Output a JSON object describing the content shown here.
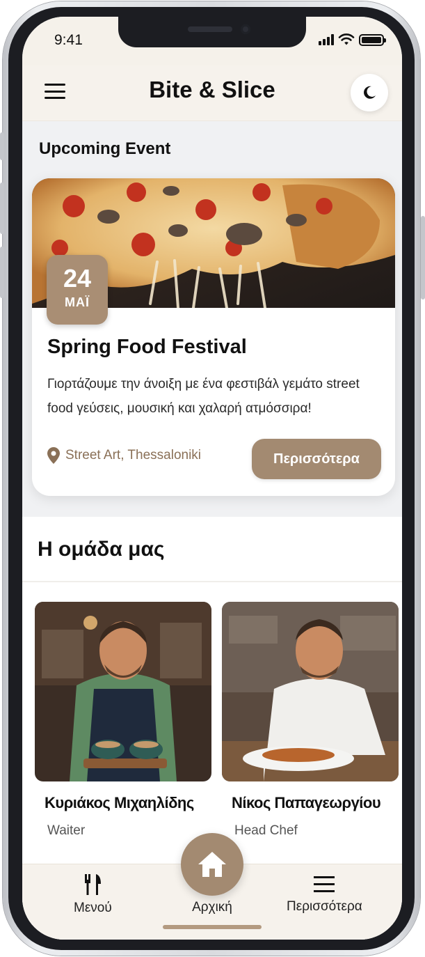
{
  "status_bar": {
    "time": "9:41"
  },
  "header": {
    "title": "Bite & Slice",
    "menu_icon": "hamburger-icon",
    "theme_icon": "moon-icon"
  },
  "event_section": {
    "title": "Upcoming Event"
  },
  "event": {
    "day": "24",
    "month": "ΜΑΪ",
    "title": "Spring Food Festival",
    "description": "Γιορτάζουμε την άνοιξη με ένα φεστιβάλ γεμάτο street food γεύσεις, μουσική και χαλαρή ατμόσσιρα!",
    "location": "Street Art, Thessaloniki",
    "more_label": "Περισσότερα"
  },
  "team_section": {
    "title": "Η ομάδα μας"
  },
  "team": [
    {
      "name": "Κυριάκος Μιχαηλίδης",
      "role": "Waiter"
    },
    {
      "name": "Νίκος Παπαγεωργίου",
      "role": "Head Chef"
    }
  ],
  "nav": {
    "menu": "Μενού",
    "home": "Αρχική",
    "more": "Περισσότερα"
  },
  "colors": {
    "accent": "#a38a71",
    "header_bg": "#f6f2ec",
    "location": "#8a7057"
  }
}
